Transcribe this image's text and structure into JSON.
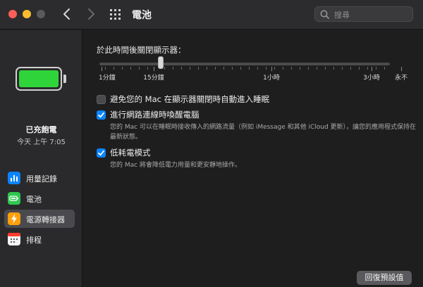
{
  "window": {
    "title": "電池",
    "search": {
      "placeholder": "搜尋"
    }
  },
  "sidebar": {
    "battery_level": 1.0,
    "status": "已充飽電",
    "status_time": "今天 上午 7:05",
    "items": [
      {
        "label": "用量記錄",
        "icon": "usage-history-icon",
        "color": "#0a84ff",
        "selected": false
      },
      {
        "label": "電池",
        "icon": "battery-icon",
        "color": "#30c750",
        "selected": false
      },
      {
        "label": "電源轉接器",
        "icon": "power-adapter-icon",
        "color": "#ff9f0a",
        "selected": true
      },
      {
        "label": "排程",
        "icon": "calendar-icon",
        "color": "#f2f2f2",
        "selected": false
      }
    ]
  },
  "main": {
    "display_off": {
      "heading": "於此時間後關閉顯示器：",
      "slider_value_fraction": 0.21,
      "ticks": [
        "1分鐘",
        "15分鐘",
        "1小時",
        "3小時",
        "永不"
      ]
    },
    "options": [
      {
        "label": "避免您的 Mac 在顯示器關閉時自動進入睡眠",
        "checked": false,
        "description": ""
      },
      {
        "label": "進行網路連線時喚醒電腦",
        "checked": true,
        "description": "您的 Mac 可以在睡眠時接收傳入的網路流量（例如 iMessage 和其他 iCloud 更新），讓您的應用程式保持在最新狀態。"
      },
      {
        "label": "低耗電模式",
        "checked": true,
        "description": "您的 Mac 將會降低電力用量和更安靜地操作。"
      }
    ],
    "restore_defaults_label": "回復預設值"
  },
  "colors": {
    "accent": "#0a84ff",
    "battery_fill": "#2fd43a",
    "close": "#fe5f57",
    "minimize": "#febc2e"
  }
}
